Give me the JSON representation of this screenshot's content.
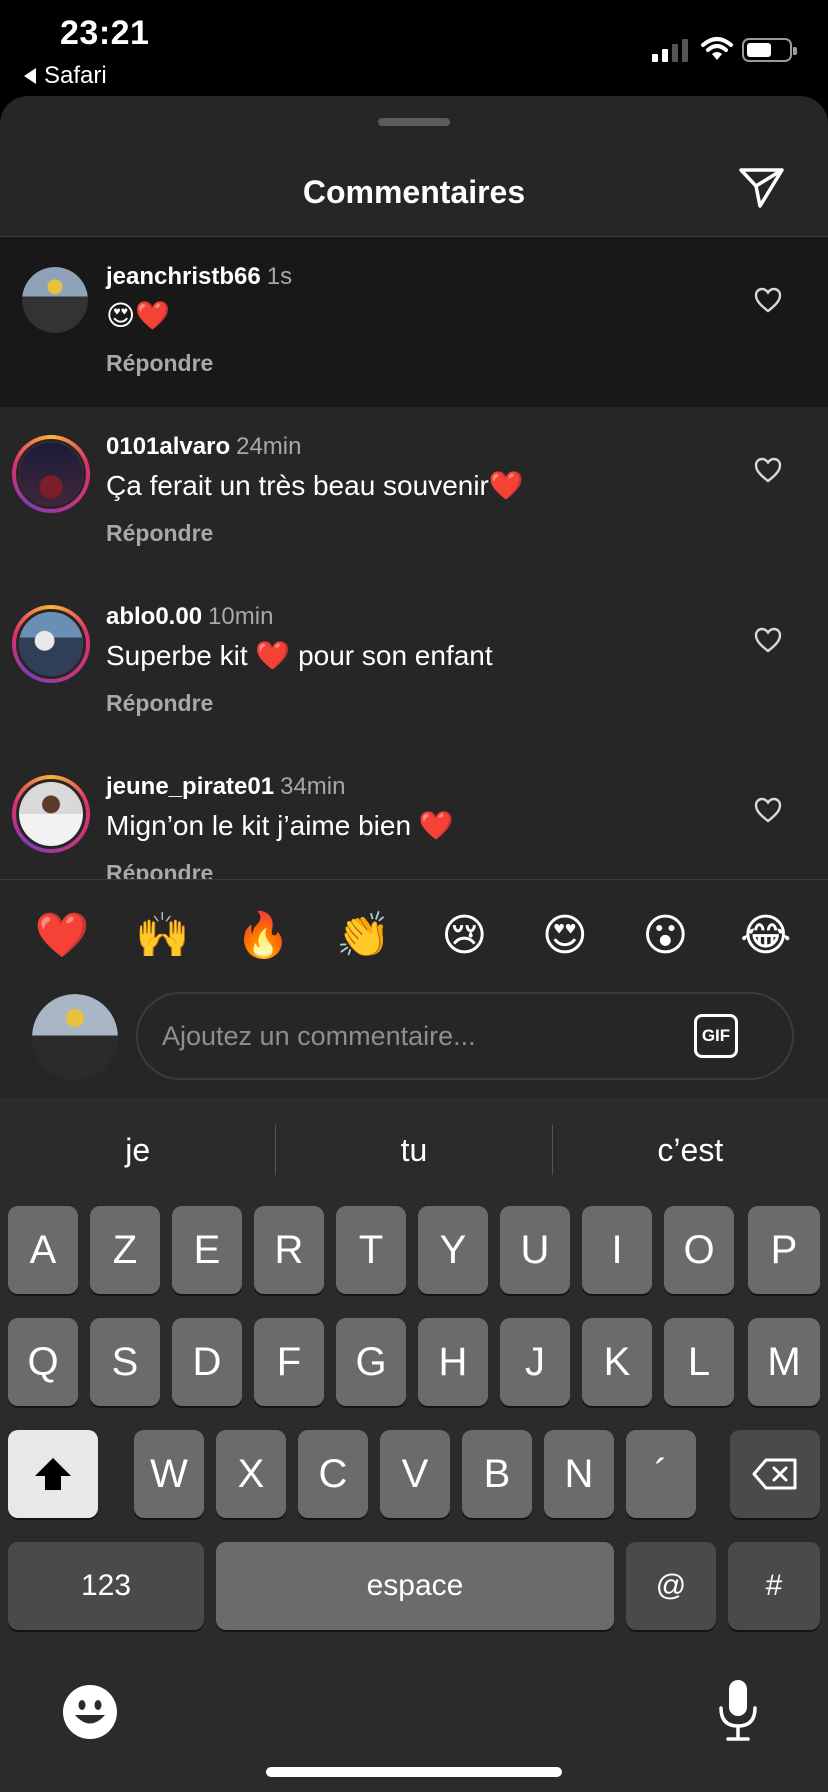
{
  "status_bar": {
    "time": "23:21",
    "back_label": "Safari",
    "battery_icon": "battery-icon",
    "wifi_icon": "wifi-icon"
  },
  "sheet": {
    "title": "Commentaires",
    "send_icon": "paper-plane-icon"
  },
  "comments": [
    {
      "user": "jeanchristb66",
      "time": "1s",
      "text": "😍❤️",
      "reply": "Répondre"
    },
    {
      "user": "0101alvaro",
      "time": "24min",
      "text": "Ça ferait un très beau souvenir❤️",
      "reply": "Répondre"
    },
    {
      "user": "ablo0.00",
      "time": "10min",
      "text": "Superbe kit ❤️ pour son enfant",
      "reply": "Répondre"
    },
    {
      "user": "jeune_pirate01",
      "time": "34min",
      "text": "Mign’on le kit j’aime bien ❤️",
      "reply": "Répondre"
    }
  ],
  "quick_emojis": [
    "❤️",
    "🙌",
    "🔥",
    "👏",
    "😢",
    "😍",
    "😮",
    "😂"
  ],
  "input": {
    "placeholder": "Ajoutez un commentaire...",
    "gif_label": "GIF"
  },
  "keyboard": {
    "suggestions": [
      "je",
      "tu",
      "c’est"
    ],
    "row1": [
      "A",
      "Z",
      "E",
      "R",
      "T",
      "Y",
      "U",
      "I",
      "O",
      "P"
    ],
    "row2": [
      "Q",
      "S",
      "D",
      "F",
      "G",
      "H",
      "J",
      "K",
      "L",
      "M"
    ],
    "row3": [
      "W",
      "X",
      "C",
      "V",
      "B",
      "N",
      "´"
    ],
    "numbers_label": "123",
    "space_label": "espace",
    "at_label": "@",
    "hash_label": "#"
  }
}
